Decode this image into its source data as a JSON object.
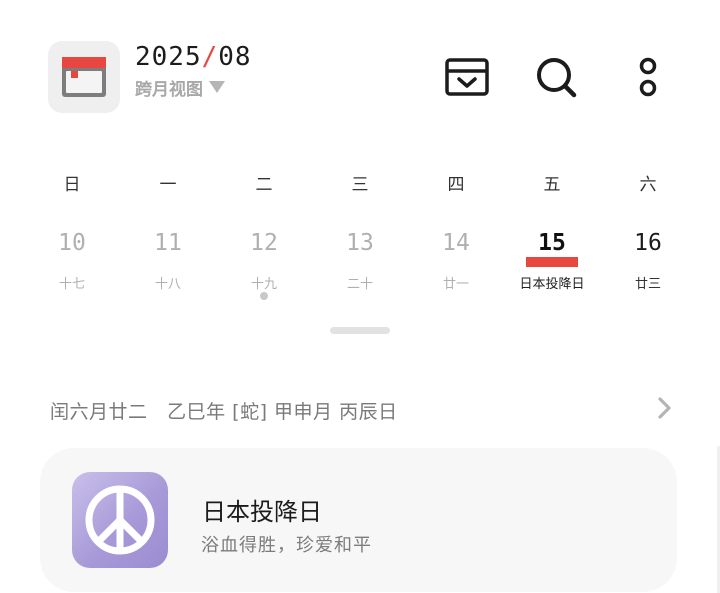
{
  "header": {
    "year": "2025",
    "separator": "/",
    "month": "08",
    "view_label": "跨月视图",
    "icons": [
      "calendar-app-icon",
      "inbox-icon",
      "search-icon",
      "more-icon"
    ],
    "accent_color": "#e8473f"
  },
  "weekdays": [
    "日",
    "一",
    "二",
    "三",
    "四",
    "五",
    "六"
  ],
  "days": [
    {
      "num": "10",
      "lunar": "十七",
      "state": "past"
    },
    {
      "num": "11",
      "lunar": "十八",
      "state": "past"
    },
    {
      "num": "12",
      "lunar": "十九",
      "state": "past",
      "has_event": true
    },
    {
      "num": "13",
      "lunar": "二十",
      "state": "past"
    },
    {
      "num": "14",
      "lunar": "廿一",
      "state": "past"
    },
    {
      "num": "15",
      "lunar": "日本投降日",
      "state": "today"
    },
    {
      "num": "16",
      "lunar": "廿三",
      "state": "future"
    }
  ],
  "lunar_info": "闰六月廿二   乙巳年 [蛇] 甲申月 丙辰日",
  "event_card": {
    "title": "日本投降日",
    "subtitle": "浴血得胜，珍爱和平",
    "icon": "peace-icon"
  }
}
